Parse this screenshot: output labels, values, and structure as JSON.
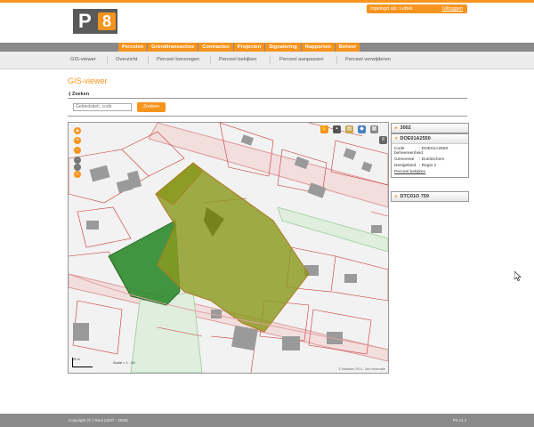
{
  "logo": {
    "letter": "P",
    "number": "8"
  },
  "user": {
    "logged_in_as": "Ingelogd als: Lettek",
    "logout": "Uitloggen"
  },
  "main_nav": [
    "Percelen",
    "Grondtransacties",
    "Contracten",
    "Projecten",
    "Signalering",
    "Rapporten",
    "Beheer"
  ],
  "sub_nav": [
    "GIS-viewer",
    "Overzicht",
    "Perceel toevoegen",
    "Perceel bekijken",
    "Perceel aanpassen",
    "Perceel verwijderen"
  ],
  "page_title": "GIS-viewer",
  "search": {
    "heading": "-| Zoeken",
    "placeholder": "Gebiedsbeh. code",
    "button": "Zoeken"
  },
  "map": {
    "scale_text": "Scale = 1 : 2K",
    "scale_bar_label": "50 m",
    "attribution": "© Kadaster 2013 - Geo Informatie"
  },
  "panels": [
    {
      "title": "3002",
      "expanded": false
    },
    {
      "title": "DOE01A2550",
      "expanded": true,
      "rows": [
        {
          "key": "Code beheereenheid",
          "value": ": DOE01A2550"
        },
        {
          "key": "Gemeente",
          "value": ": Doetinchem"
        },
        {
          "key": "Deelgebied",
          "value": ": Regio 2"
        }
      ],
      "link": "Perceel bekijken"
    },
    {
      "title": "DTC01O 759",
      "expanded": false
    }
  ],
  "footer": {
    "copyright": "Copyright (© ) Real (2007 - 2008)",
    "version": "P8 v1.2"
  },
  "colors": {
    "accent": "#f7941d",
    "nav_grey": "#8a8a8a",
    "parcel_olive": "#8a9a20",
    "parcel_green": "#2e8b2e"
  }
}
